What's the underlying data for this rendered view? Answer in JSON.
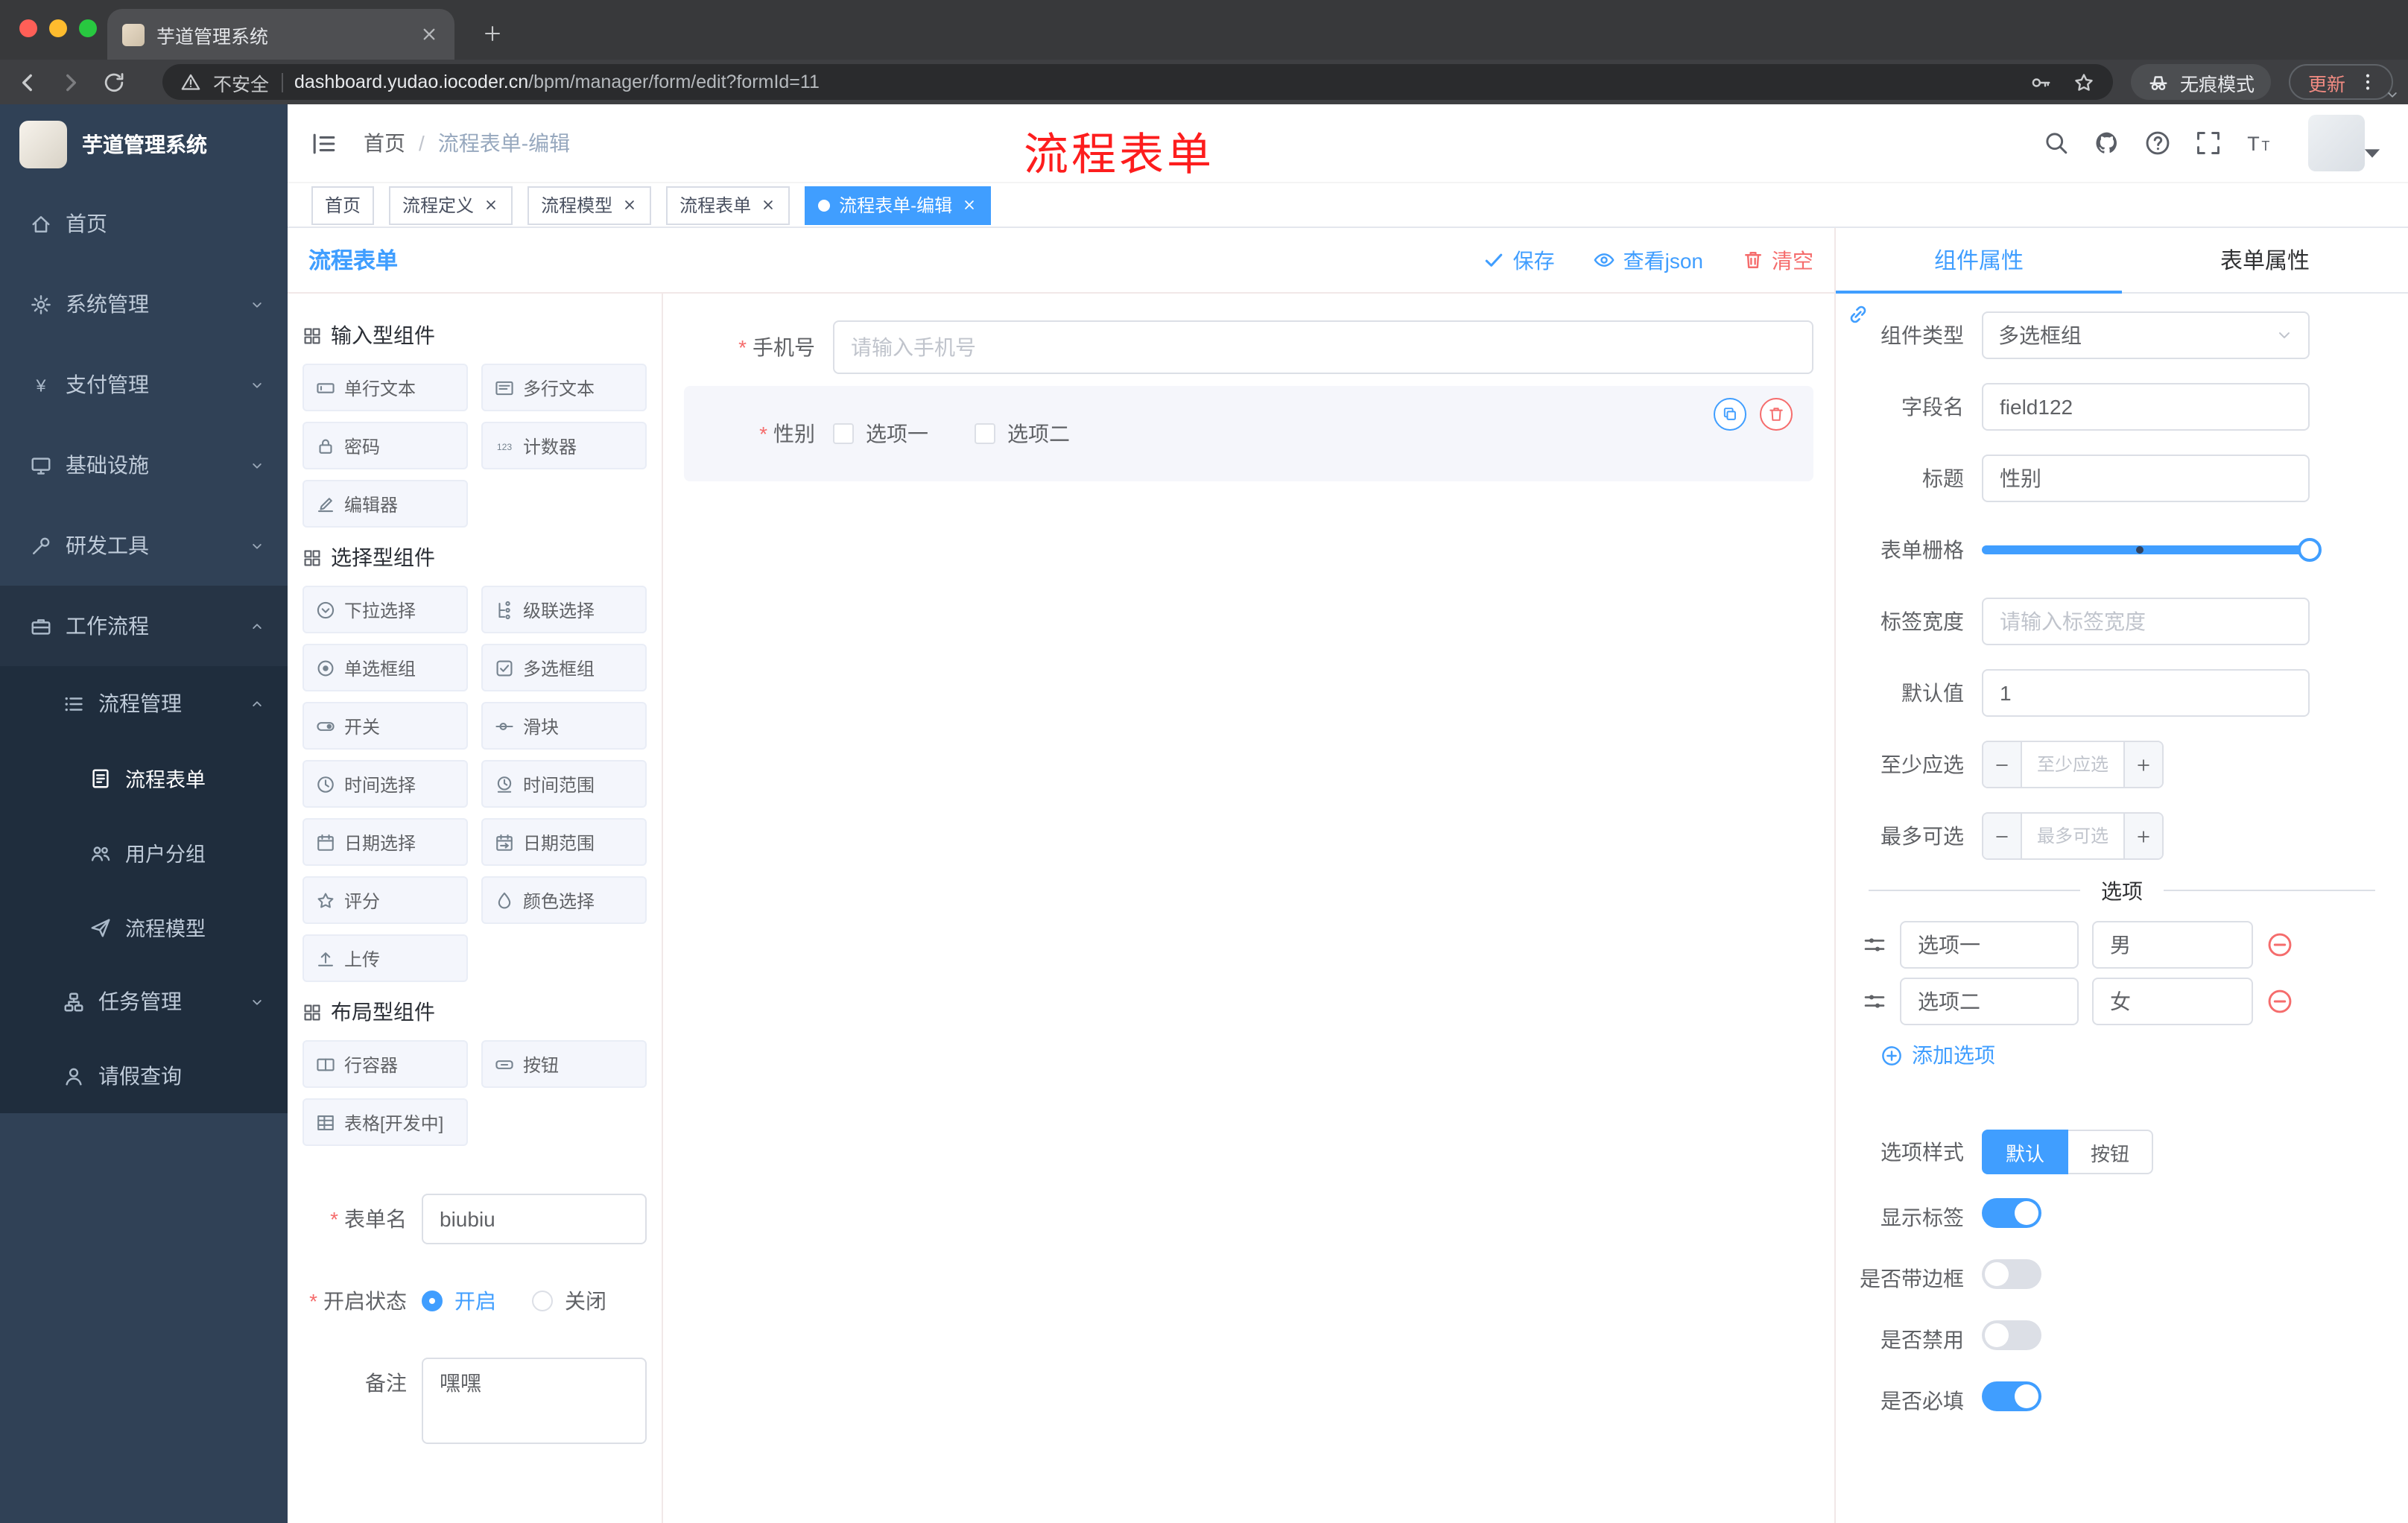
{
  "colors": {
    "accent": "#409EFF",
    "danger": "#F56C6C",
    "annotation_red": "#FD1D1D",
    "sidebar_bg": "#304156",
    "sidebar_submenu_bg": "#1F2D3D",
    "chrome_bg": "#38393B"
  },
  "browser": {
    "tab_title": "芋道管理系统",
    "security_label": "不安全",
    "url_host": "dashboard.yudao.iocoder.cn",
    "url_path": "/bpm/manager/form/edit?formId=11",
    "incognito_label": "无痕模式",
    "update_label": "更新"
  },
  "sidebar": {
    "logo_title": "芋道管理系统",
    "items": [
      {
        "key": "home",
        "label": "首页",
        "level": 1
      },
      {
        "key": "system",
        "label": "系统管理",
        "level": 1,
        "arrow": "down"
      },
      {
        "key": "payment",
        "label": "支付管理",
        "level": 1,
        "arrow": "down"
      },
      {
        "key": "infrastructure",
        "label": "基础设施",
        "level": 1,
        "arrow": "down"
      },
      {
        "key": "devtools",
        "label": "研发工具",
        "level": 1,
        "arrow": "down"
      },
      {
        "key": "workflow",
        "label": "工作流程",
        "level": 1,
        "arrow": "up",
        "open": true
      },
      {
        "key": "process-manage",
        "label": "流程管理",
        "level": 2,
        "arrow": "up",
        "open": true
      },
      {
        "key": "process-form",
        "label": "流程表单",
        "level": 3,
        "active": true
      },
      {
        "key": "user-group",
        "label": "用户分组",
        "level": 3
      },
      {
        "key": "process-model",
        "label": "流程模型",
        "level": 3
      },
      {
        "key": "task-manage",
        "label": "任务管理",
        "level": 2,
        "arrow": "down"
      },
      {
        "key": "leave-query",
        "label": "请假查询",
        "level": 2
      }
    ]
  },
  "navbar": {
    "breadcrumb_home": "首页",
    "breadcrumb_separator": "/",
    "breadcrumb_current": "流程表单-编辑",
    "annotation_title": "流程表单"
  },
  "tags": [
    {
      "key": "home",
      "label": "首页",
      "closable": false,
      "active": false
    },
    {
      "key": "process-definition",
      "label": "流程定义",
      "closable": true,
      "active": false
    },
    {
      "key": "process-model",
      "label": "流程模型",
      "closable": true,
      "active": false
    },
    {
      "key": "process-form",
      "label": "流程表单",
      "closable": true,
      "active": false
    },
    {
      "key": "process-form-edit",
      "label": "流程表单-编辑",
      "closable": true,
      "active": true
    }
  ],
  "designer": {
    "title": "流程表单",
    "save_label": "保存",
    "view_json_label": "查看json",
    "clear_label": "清空"
  },
  "palette": {
    "groups": [
      {
        "title": "输入型组件",
        "items": [
          {
            "key": "text-input",
            "label": "单行文本"
          },
          {
            "key": "textarea",
            "label": "多行文本"
          },
          {
            "key": "password",
            "label": "密码"
          },
          {
            "key": "counter",
            "label": "计数器"
          },
          {
            "key": "editor",
            "label": "编辑器"
          }
        ]
      },
      {
        "title": "选择型组件",
        "items": [
          {
            "key": "select",
            "label": "下拉选择"
          },
          {
            "key": "cascader",
            "label": "级联选择"
          },
          {
            "key": "radio-group",
            "label": "单选框组"
          },
          {
            "key": "checkbox-group",
            "label": "多选框组"
          },
          {
            "key": "switch",
            "label": "开关"
          },
          {
            "key": "slider",
            "label": "滑块"
          },
          {
            "key": "time",
            "label": "时间选择"
          },
          {
            "key": "time-range",
            "label": "时间范围"
          },
          {
            "key": "date",
            "label": "日期选择"
          },
          {
            "key": "date-range",
            "label": "日期范围"
          },
          {
            "key": "rate",
            "label": "评分"
          },
          {
            "key": "color",
            "label": "颜色选择"
          },
          {
            "key": "upload",
            "label": "上传"
          }
        ]
      },
      {
        "title": "布局型组件",
        "items": [
          {
            "key": "row-container",
            "label": "行容器"
          },
          {
            "key": "button",
            "label": "按钮"
          },
          {
            "key": "table",
            "label": "表格[开发中]"
          }
        ]
      }
    ],
    "meta": {
      "form_name_label": "表单名",
      "form_name_value": "biubiu",
      "status_label": "开启状态",
      "status_options": [
        {
          "label": "开启",
          "checked": true
        },
        {
          "label": "关闭",
          "checked": false
        }
      ],
      "remark_label": "备注",
      "remark_value": "嘿嘿"
    }
  },
  "canvas": {
    "phone_field": {
      "label": "手机号",
      "placeholder": "请输入手机号",
      "required": true
    },
    "gender_field": {
      "label": "性别",
      "required": true,
      "options": [
        "选项一",
        "选项二"
      ]
    }
  },
  "props": {
    "tab_component": "组件属性",
    "tab_form": "表单属性",
    "component_type_label": "组件类型",
    "component_type_value": "多选框组",
    "field_name_label": "字段名",
    "field_name_value": "field122",
    "title_label": "标题",
    "title_value": "性别",
    "grid_label": "表单栅格",
    "label_width_label": "标签宽度",
    "label_width_placeholder": "请输入标签宽度",
    "default_label": "默认值",
    "default_value": "1",
    "min_label": "至少应选",
    "min_placeholder": "至少应选",
    "max_label": "最多可选",
    "max_placeholder": "最多可选",
    "options_divider": "选项",
    "options": [
      {
        "name": "选项一",
        "value": "男"
      },
      {
        "name": "选项二",
        "value": "女"
      }
    ],
    "add_option_label": "添加选项",
    "option_style_label": "选项样式",
    "option_style_options": [
      "默认",
      "按钮"
    ],
    "option_style_active": "默认",
    "toggles": [
      {
        "key": "show-label",
        "label": "显示标签",
        "on": true
      },
      {
        "key": "border",
        "label": "是否带边框",
        "on": false
      },
      {
        "key": "disabled",
        "label": "是否禁用",
        "on": false
      },
      {
        "key": "required",
        "label": "是否必填",
        "on": true
      }
    ]
  }
}
